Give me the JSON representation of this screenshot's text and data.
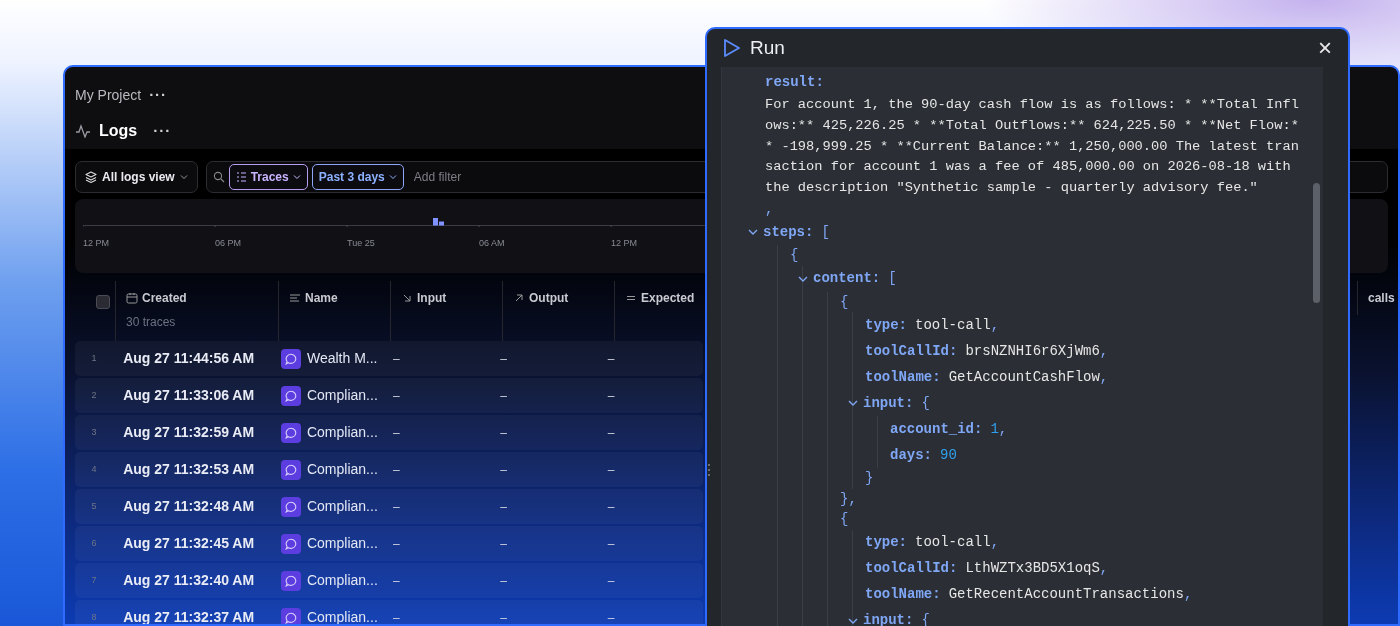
{
  "project": {
    "title": "My Project",
    "menu": "···"
  },
  "page": {
    "title": "Logs",
    "menu": "···"
  },
  "toolbar": {
    "view": "All logs view",
    "filters": [
      {
        "label": "Traces",
        "kind": "type"
      },
      {
        "label": "Past 3 days",
        "kind": "time"
      }
    ],
    "search": {
      "placeholder": "Add filter"
    }
  },
  "histogram": {
    "axis_labels": [
      "12 PM",
      "06 PM",
      "Tue 25",
      "06 AM",
      "12 PM"
    ]
  },
  "table": {
    "select_all": {
      "checked": false
    },
    "columns": [
      {
        "label": "Created",
        "sub": "30 traces"
      },
      {
        "label": "Name"
      },
      {
        "label": "Input"
      },
      {
        "label": "Output"
      },
      {
        "label": "Expected"
      },
      {
        "label": "calls"
      }
    ],
    "rows": [
      {
        "index": "1",
        "created": "Aug 27 11:44:56 AM",
        "name": "Wealth M...",
        "input": "–",
        "output": "–",
        "expected": "–"
      },
      {
        "index": "2",
        "created": "Aug 27 11:33:06 AM",
        "name": "Complian...",
        "input": "–",
        "output": "–",
        "expected": "–"
      },
      {
        "index": "3",
        "created": "Aug 27 11:32:59 AM",
        "name": "Complian...",
        "input": "–",
        "output": "–",
        "expected": "–"
      },
      {
        "index": "4",
        "created": "Aug 27 11:32:53 AM",
        "name": "Complian...",
        "input": "–",
        "output": "–",
        "expected": "–"
      },
      {
        "index": "5",
        "created": "Aug 27 11:32:48 AM",
        "name": "Complian...",
        "input": "–",
        "output": "–",
        "expected": "–"
      },
      {
        "index": "6",
        "created": "Aug 27 11:32:45 AM",
        "name": "Complian...",
        "input": "–",
        "output": "–",
        "expected": "–"
      },
      {
        "index": "7",
        "created": "Aug 27 11:32:40 AM",
        "name": "Complian...",
        "input": "–",
        "output": "–",
        "expected": "–"
      },
      {
        "index": "8",
        "created": "Aug 27 11:32:37 AM",
        "name": "Complian...",
        "input": "–",
        "output": "–",
        "expected": "–"
      }
    ]
  },
  "run_panel": {
    "title": "Run",
    "close": "×",
    "tree": [
      {
        "key": "result:",
        "value": "For account 1, the 90-day cash flow is as follows: * **Total Inflows:** 425,226.25 * **Total Outflows:** 624,225.50 * **Net Flow:** -198,999.25 * **Current Balance:** 1,250,000.00 The latest transaction for account 1 was a fee of 485,000.00 on 2026-08-18 with the description \"Synthetic sample - quarterly advisory fee.\"",
        "kind": "text"
      },
      {
        "text": ","
      },
      {
        "key": "steps:",
        "open": "[",
        "expanded": true,
        "children": [
          {
            "text": "{",
            "children": [
              {
                "key": "content:",
                "open": "[",
                "expanded": true,
                "children": [
                  {
                    "text": "{",
                    "children": [
                      {
                        "key": "type:",
                        "value": "tool-call",
                        "kind": "string",
                        "comma": ","
                      },
                      {
                        "key": "toolCallId:",
                        "value": "brsNZNHI6r6XjWm6",
                        "kind": "string",
                        "comma": ","
                      },
                      {
                        "key": "toolName:",
                        "value": "GetAccountCashFlow",
                        "kind": "string",
                        "comma": ","
                      },
                      {
                        "key": "input:",
                        "open": "{",
                        "expanded": true,
                        "children": [
                          {
                            "key": "account_id:",
                            "value": "1",
                            "kind": "number",
                            "comma": ","
                          },
                          {
                            "key": "days:",
                            "value": "90",
                            "kind": "number"
                          }
                        ]
                      },
                      {
                        "text": "}"
                      }
                    ]
                  },
                  {
                    "text": "},"
                  },
                  {
                    "text": "{",
                    "children": [
                      {
                        "key": "type:",
                        "value": "tool-call",
                        "kind": "string",
                        "comma": ","
                      },
                      {
                        "key": "toolCallId:",
                        "value": "LthWZTx3BD5X1oqS",
                        "kind": "string",
                        "comma": ","
                      },
                      {
                        "key": "toolName:",
                        "value": "GetRecentAccountTransactions",
                        "kind": "string",
                        "comma": ","
                      },
                      {
                        "key": "input:",
                        "open": "{",
                        "expanded": true
                      }
                    ]
                  }
                ]
              }
            ]
          }
        ]
      }
    ]
  }
}
